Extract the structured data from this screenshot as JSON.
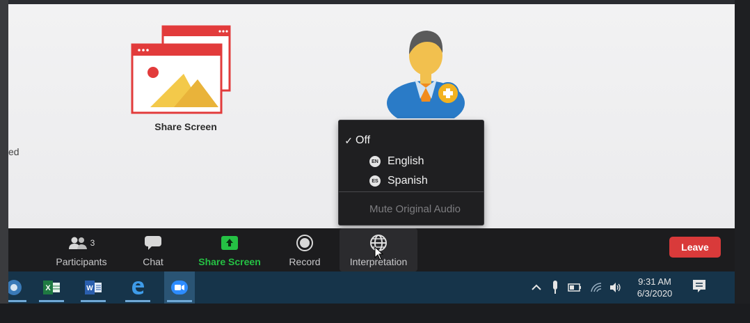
{
  "meeting": {
    "partial_left_text": "ed",
    "share_tile_label": "Share Screen"
  },
  "interpretation_menu": {
    "items": [
      {
        "label": "Off",
        "checked": true,
        "badge": ""
      },
      {
        "label": "English",
        "checked": false,
        "badge": "EN"
      },
      {
        "label": "Spanish",
        "checked": false,
        "badge": "ES"
      }
    ],
    "mute_original_audio": "Mute Original Audio",
    "check_mark": "✓"
  },
  "toolbar": {
    "participants_label": "Participants",
    "participants_count": "3",
    "chat_label": "Chat",
    "share_screen_label": "Share Screen",
    "record_label": "Record",
    "interpretation_label": "Interpretation",
    "leave_label": "Leave"
  },
  "taskbar": {
    "apps": [
      "chrome-icon",
      "excel-icon",
      "word-icon",
      "edge-icon",
      "zoom-icon"
    ],
    "time": "9:31 AM",
    "date": "6/3/2020"
  },
  "colors": {
    "share_green": "#25c144",
    "leave_red": "#d93a3a",
    "menu_bg": "#1f1f21",
    "toolbar_bg": "#1c1c1e",
    "taskbar_bg": "#16344a"
  }
}
